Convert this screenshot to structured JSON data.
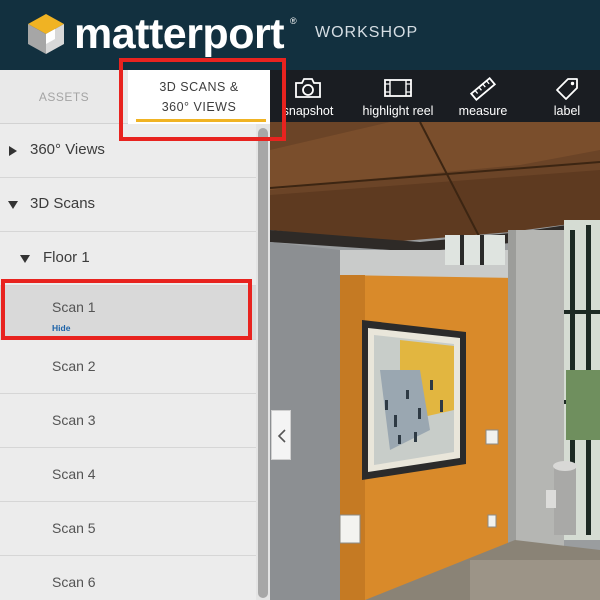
{
  "header": {
    "brand": "matterport",
    "registered": "®",
    "product": "WORKSHOP"
  },
  "tabs": {
    "assets": "ASSETS",
    "scans_line1": "3D SCANS &",
    "scans_line2": "360° VIEWS"
  },
  "toolbar": {
    "snapshot": "snapshot",
    "highlight_reel": "highlight reel",
    "measure": "measure",
    "label": "label"
  },
  "tree": {
    "views360": "360° Views",
    "scans3d": "3D Scans",
    "floor": "Floor 1",
    "scans": [
      {
        "label": "Scan 1",
        "action": "Hide"
      },
      {
        "label": "Scan 2"
      },
      {
        "label": "Scan 3"
      },
      {
        "label": "Scan 4"
      },
      {
        "label": "Scan 5"
      },
      {
        "label": "Scan 6"
      }
    ]
  },
  "colors": {
    "header_bg": "#12303f",
    "accent_underline": "#f0b323",
    "highlight_red": "#e8231f",
    "link_blue": "#1c62a8"
  },
  "icons": [
    "matterport-logo-icon",
    "camera-icon",
    "film-strip-icon",
    "ruler-icon",
    "tag-icon",
    "caret-right-icon",
    "caret-down-icon",
    "chevron-left-icon"
  ]
}
